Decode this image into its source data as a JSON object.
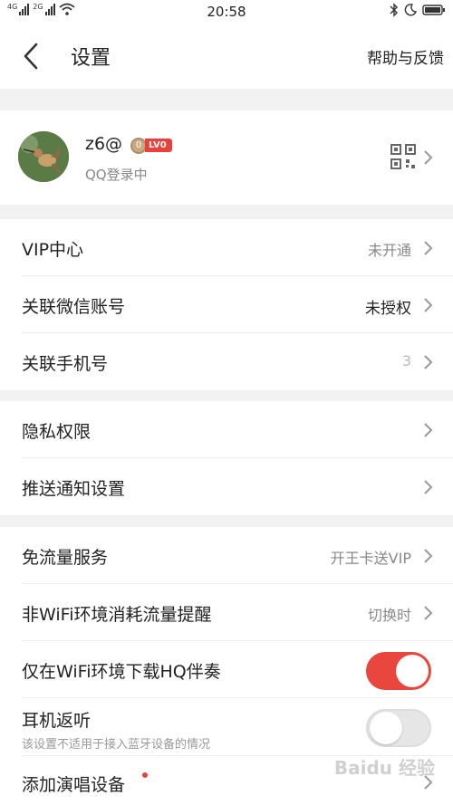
{
  "status_bar": {
    "net1": "4G",
    "net2": "2G",
    "time": "20:58",
    "icons": [
      "signal-icon",
      "signal-icon",
      "wifi-icon",
      "bluetooth-icon",
      "moon-icon",
      "battery-icon"
    ]
  },
  "nav": {
    "back_icon": "chevron-left-icon",
    "title": "设置",
    "help": "帮助与反馈"
  },
  "profile": {
    "username": "z6@",
    "coin": "0",
    "level": "LV0",
    "login_status": "QQ登录中",
    "qr_icon": "qr-code-icon"
  },
  "group1": [
    {
      "label": "VIP中心",
      "value": "未开通"
    },
    {
      "label": "关联微信账号",
      "value": "未授权"
    },
    {
      "label": "关联手机号",
      "value": "3"
    }
  ],
  "group2": [
    {
      "label": "隐私权限"
    },
    {
      "label": "推送通知设置"
    }
  ],
  "group3": {
    "free_traffic": {
      "label": "免流量服务",
      "value": "开王卡送VIP"
    },
    "nonwifi": {
      "label": "非WiFi环境消耗流量提醒",
      "value": "切换时"
    },
    "wifi_hq": {
      "label": "仅在WiFi环境下载HQ伴奏",
      "on": true
    },
    "earphone": {
      "label": "耳机返听",
      "sub": "该设置不适用于接入蓝牙设备的情况",
      "on": false
    },
    "add_device": {
      "label": "添加演唱设备"
    }
  },
  "watermark": "Baidu 经验",
  "colors": {
    "accent": "#e9473d",
    "divider": "#f2f2f2"
  }
}
